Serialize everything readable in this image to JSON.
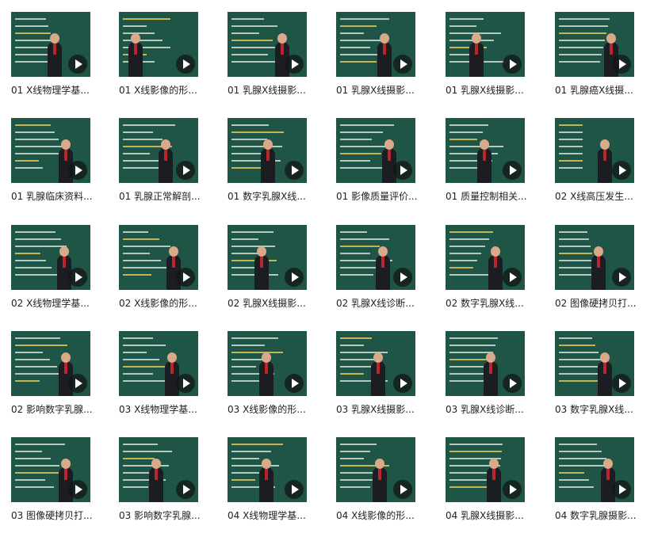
{
  "colors": {
    "board": "#1e5546",
    "chalk": "#e8efe4",
    "highlight": "#e2c85a",
    "title_text": "#222222",
    "play_button": "#141414"
  },
  "play_icon": "play-icon",
  "videos": [
    {
      "title": "01 X线物理学基",
      "ellipsis": "..."
    },
    {
      "title": "01 X线影像的形",
      "ellipsis": "..."
    },
    {
      "title": "01 乳腺X线摄影",
      "ellipsis": "..."
    },
    {
      "title": "01 乳腺X线摄影",
      "ellipsis": "..."
    },
    {
      "title": "01 乳腺X线摄影",
      "ellipsis": "..."
    },
    {
      "title": "01 乳腺癌X线摄",
      "ellipsis": "..."
    },
    {
      "title": "01 乳腺临床资料",
      "ellipsis": "..."
    },
    {
      "title": "01 乳腺正常解剖",
      "ellipsis": "..."
    },
    {
      "title": "01 数字乳腺X线",
      "ellipsis": "..."
    },
    {
      "title": "01 影像质量评价",
      "ellipsis": "..."
    },
    {
      "title": "01 质量控制相关",
      "ellipsis": "..."
    },
    {
      "title": "02 X线高压发生",
      "ellipsis": "..."
    },
    {
      "title": "02 X线物理学基",
      "ellipsis": "..."
    },
    {
      "title": "02 X线影像的形",
      "ellipsis": "..."
    },
    {
      "title": "02 乳腺X线摄影",
      "ellipsis": "..."
    },
    {
      "title": "02 乳腺X线诊断",
      "ellipsis": "..."
    },
    {
      "title": "02 数字乳腺X线",
      "ellipsis": "..."
    },
    {
      "title": "02 图像硬拷贝打",
      "ellipsis": "..."
    },
    {
      "title": "02 影响数字乳腺",
      "ellipsis": "..."
    },
    {
      "title": "03 X线物理学基",
      "ellipsis": "..."
    },
    {
      "title": "03 X线影像的形",
      "ellipsis": "..."
    },
    {
      "title": "03 乳腺X线摄影",
      "ellipsis": "..."
    },
    {
      "title": "03 乳腺X线诊断",
      "ellipsis": "..."
    },
    {
      "title": "03 数字乳腺X线",
      "ellipsis": "..."
    },
    {
      "title": "03 图像硬拷贝打",
      "ellipsis": "..."
    },
    {
      "title": "03 影响数字乳腺",
      "ellipsis": "..."
    },
    {
      "title": "04 X线物理学基",
      "ellipsis": "..."
    },
    {
      "title": "04 X线影像的形",
      "ellipsis": "..."
    },
    {
      "title": "04 乳腺X线摄影",
      "ellipsis": "..."
    },
    {
      "title": "04 数字乳腺摄影",
      "ellipsis": "..."
    }
  ]
}
